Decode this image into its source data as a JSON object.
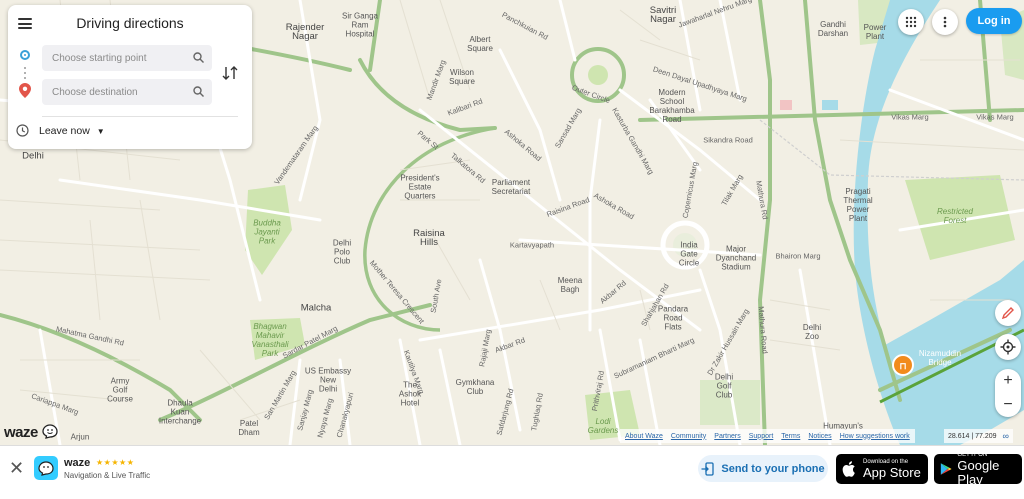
{
  "panel": {
    "title": "Driving directions",
    "start_placeholder": "Choose starting point",
    "dest_placeholder": "Choose destination",
    "leave_label": "Leave now"
  },
  "header": {
    "login_label": "Log in"
  },
  "map_labels": {
    "rajender_nagar": "Rajender\nNagar",
    "sir_ganga_ram": "Sir Ganga\nRam\nHospital",
    "albert_square": "Albert\nSquare",
    "wilson_square": "Wilson\nSquare",
    "mandir_marg": "Mandir Marg",
    "kalibari_rd": "Kalibari Rd",
    "panchkuian_rd": "Panchkuian Rd",
    "outer_circle": "Outer Circle",
    "savitri_nagar": "Savitri\nNagar",
    "jawaharlal_nehru_marg": "Jawaharlal Nehru Marg",
    "gandhi_darshan": "Gandhi\nDarshan",
    "power_plant": "Power\nPlant",
    "deen_dayal": "Deen Dayal Upadhyaya Marg",
    "modern_school": "Modern\nSchool\nBarakhamba\nRoad",
    "vikas_marg": "Vikas Marg",
    "vikas_marg2": "Vikas Marg",
    "delhi": "Delhi",
    "park_st": "Park St",
    "ashoka_road": "Ashoka Road",
    "sansad_marg": "Sansad Marg",
    "kasturba": "Kasturba Gandhi Marg",
    "sikandra_road": "Sikandra Road",
    "talkatora": "Talkatora Rd",
    "presidents_estate": "President's\nEstate\nQuarters",
    "parliament": "Parliament\nSecretariat",
    "vandematram": "Vandemataram Marg",
    "buddha_jayanti": "Buddha\nJayanti\nPark",
    "raisina_hills": "Raisina\nHills",
    "raisina_road": "Raisina Road",
    "ashoka_road2": "Ashoka Road",
    "kartavyapath": "Kartavyapath",
    "copernicus": "Copernicus Marg",
    "tilak_marg": "Tilak Marg",
    "mathura_rd": "Mathura Rd",
    "pragati": "Pragati\nThermal\nPower\nPlant",
    "restricted_forest": "Restricted\nForest",
    "delhi_polo": "Delhi\nPolo\nClub",
    "india_gate": "India\nGate\nCircle",
    "major_dyanchand": "Major\nDyanchand\nStadium",
    "bhairon_marg": "Bhairon Marg",
    "mother_teresa": "Mother Teresa Crescent",
    "south_ave": "South Ave",
    "meena_bagh": "Meena\nBagh",
    "akbar_rd": "Akbar Rd",
    "shahjahan_rd": "Shahjahan Rd",
    "pandara": "Pandara\nRoad\nFlats",
    "zakir_hussain": "Dr Zakir Hussain Marg",
    "mathura_road2": "Mathura Road",
    "delhi_zoo": "Delhi\nZoo",
    "malcha": "Malcha",
    "mahatma_gandhi_rd": "Mahatma Gandhi Rd",
    "bhagwan_mahavir": "Bhagwan\nMahavir\nVanasthali\nPark",
    "sardar_patel": "Sardar Patel Marg",
    "us_embassy": "US Embassy\nNew\nDelhi",
    "kautilya": "Kautilya Marg",
    "ashok_hotel": "The\nAshok\nHotel",
    "akbar_rd2": "Akbar Rd",
    "rajaji_marg": "Rajaji Marg",
    "gymkhana": "Gymkhana\nClub",
    "prithviraj": "Prithviraj Rd",
    "subramaniam": "Subramaniam Bharti Marg",
    "tughlaq": "Tughlaq Rd",
    "safdarjung": "Safdarjung Rd",
    "delhi_golf": "Delhi\nGolf\nClub",
    "nizamuddin_bridge": "Nizamuddin\nBridge",
    "army_golf": "Army\nGolf\nCourse",
    "dhaula_kuan": "Dhaula\nKuan\nInterchange",
    "cariappa": "Cariappa Marg",
    "arjun": "Arjun",
    "patel_dham": "Patel\nDham",
    "sanjay_marg": "Sanjay Marg",
    "lodi_gardens": "Lodi\nGardens",
    "humayuns": "Humayun's",
    "sa_ring": "Sardar Patel Marg",
    "chanakyapuri": "Chanakyapuri",
    "nyaya_marg": "Nyaya Marg",
    "san_martin": "San Martin Marg"
  },
  "footer_links": [
    "About Waze",
    "Community",
    "Partners",
    "Support",
    "Terms",
    "Notices",
    "How suggestions work"
  ],
  "coords": "28.614 | 77.209",
  "logo": "waze",
  "banner": {
    "app_name": "waze",
    "stars": "★★★★★",
    "subtitle": "Navigation & Live Traffic",
    "send_label": "Send to your phone",
    "appstore_top": "Download on the",
    "appstore_bottom": "App Store",
    "gplay_top": "GET IT ON",
    "gplay_bottom": "Google Play"
  },
  "colors": {
    "accent": "#1a9cf0",
    "river": "#a6dbe8",
    "park": "#cfe5b0",
    "major_road": "#9fc58a",
    "road": "#ffffff"
  }
}
